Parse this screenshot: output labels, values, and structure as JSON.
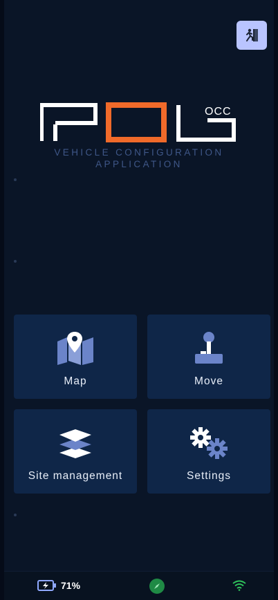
{
  "app": {
    "tagline_line1": "VEHICLE CONFIGURATION",
    "tagline_line2": "APPLICATION",
    "logo_text": "ROS OCC"
  },
  "header": {
    "exit_icon": "exit-run-icon"
  },
  "menu": {
    "items": [
      {
        "label": "Map",
        "icon": "map-pin-icon"
      },
      {
        "label": "Move",
        "icon": "joystick-icon"
      },
      {
        "label": "Site management",
        "icon": "layers-icon"
      },
      {
        "label": "Settings",
        "icon": "gears-icon"
      }
    ]
  },
  "status": {
    "battery": "71%",
    "battery_icon": "battery-charging-icon",
    "compass_icon": "compass-icon",
    "wifi_icon": "wifi-icon"
  },
  "colors": {
    "background": "#0a1527",
    "tile": "#0f2648",
    "icon_blue": "#6b84c9",
    "accent_orange": "#f06a2a",
    "exit_button": "#b9c4ff",
    "status_green": "#2fc25b"
  }
}
